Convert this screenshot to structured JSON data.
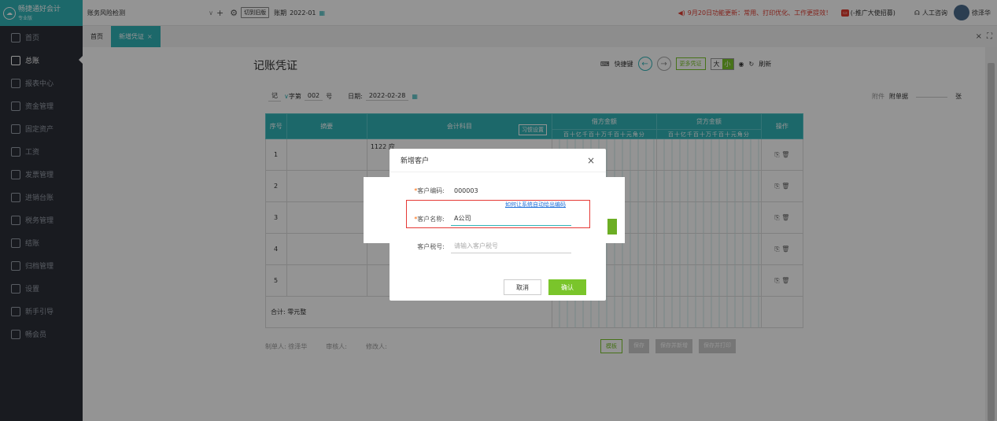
{
  "app": {
    "name": "畅捷通好会计",
    "edition": "专业版"
  },
  "topbar": {
    "company": "账务风险检测",
    "switch_label": "切到旧版",
    "period_label": "账期",
    "period_value": "2022-01",
    "notice": "9月20日功能更新：常用、打印优化、工作更提效！",
    "promo": "(-推广大使招募)",
    "support": "人工咨询",
    "user": "徐泽华"
  },
  "sidebar": {
    "items": [
      {
        "label": "首页"
      },
      {
        "label": "总账",
        "active": true
      },
      {
        "label": "报表中心"
      },
      {
        "label": "资金管理"
      },
      {
        "label": "固定资产"
      },
      {
        "label": "工资"
      },
      {
        "label": "发票管理"
      },
      {
        "label": "进销台账"
      },
      {
        "label": "税务管理"
      },
      {
        "label": "结账"
      },
      {
        "label": "归档管理"
      },
      {
        "label": "设置"
      },
      {
        "label": "新手引导"
      },
      {
        "label": "畅会员"
      }
    ]
  },
  "tabs": [
    {
      "label": "首页"
    },
    {
      "label": "新增凭证",
      "active": true,
      "close": "×"
    }
  ],
  "voucher": {
    "title": "记账凭证",
    "shortcut": "快捷键",
    "more": "更多凭证",
    "zoom": [
      "大",
      "小"
    ],
    "refresh": "刷新",
    "word": "记",
    "zi_label": "字第",
    "number": "002",
    "hao": "号",
    "date_label": "日期:",
    "date": "2022-02-28",
    "attach_btn": "附件",
    "attach_label": "附单据",
    "attach_unit": "张",
    "headers": {
      "no": "序号",
      "summary": "摘要",
      "account": "会计科目",
      "habit": "习惯设置",
      "debit": "借方金额",
      "credit": "贷方金额",
      "ops": "操作",
      "digits": "百十亿千百十万千百十元角分"
    },
    "rows": [
      {
        "no": "1",
        "account": "1122 应"
      },
      {
        "no": "2",
        "account": ""
      },
      {
        "no": "3",
        "account": ""
      },
      {
        "no": "4",
        "account": ""
      },
      {
        "no": "5",
        "account": ""
      }
    ],
    "total_label": "合计: 零元整",
    "maker": "制单人: 徐泽华",
    "auditor": "审核人:",
    "modifier": "修改人:",
    "footer_btns": [
      "模板",
      "保存",
      "保存并新增",
      "保存并打印"
    ]
  },
  "dialog": {
    "title": "新增客户",
    "close": "×",
    "code_label": "客户编码:",
    "code_value": "000003",
    "hint": "如何让系统自动给出编码",
    "name_label": "客户名称:",
    "name_value": "A公司",
    "tax_label": "客户税号:",
    "tax_placeholder": "请输入客户税号",
    "cancel": "取消",
    "confirm": "确认",
    "required_mark": "*"
  },
  "colors": {
    "teal": "#31b3b7",
    "green": "#7ac52b",
    "sidebar": "#2b2f38",
    "highlight": "#e53935"
  }
}
